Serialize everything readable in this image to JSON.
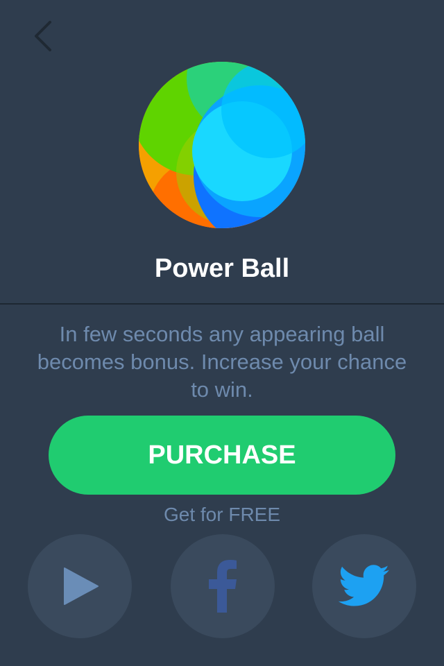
{
  "app": {
    "title": "Power Ball"
  },
  "description": "In few seconds any appearing ball becomes bonus. Increase your chance to win.",
  "purchase": {
    "label": "PURCHASE"
  },
  "free": {
    "label": "Get for FREE"
  },
  "icons": {
    "back": "chevron-left-icon",
    "play": "play-icon",
    "facebook": "facebook-icon",
    "twitter": "twitter-icon"
  },
  "colors": {
    "background": "#2f3d4e",
    "button_green": "#20cc70",
    "muted_text": "#6e8aad",
    "circle_bg": "#3a4a5d",
    "play_icon": "#6a8db7",
    "facebook_icon": "#3b5998",
    "twitter_icon": "#1da1f2"
  }
}
